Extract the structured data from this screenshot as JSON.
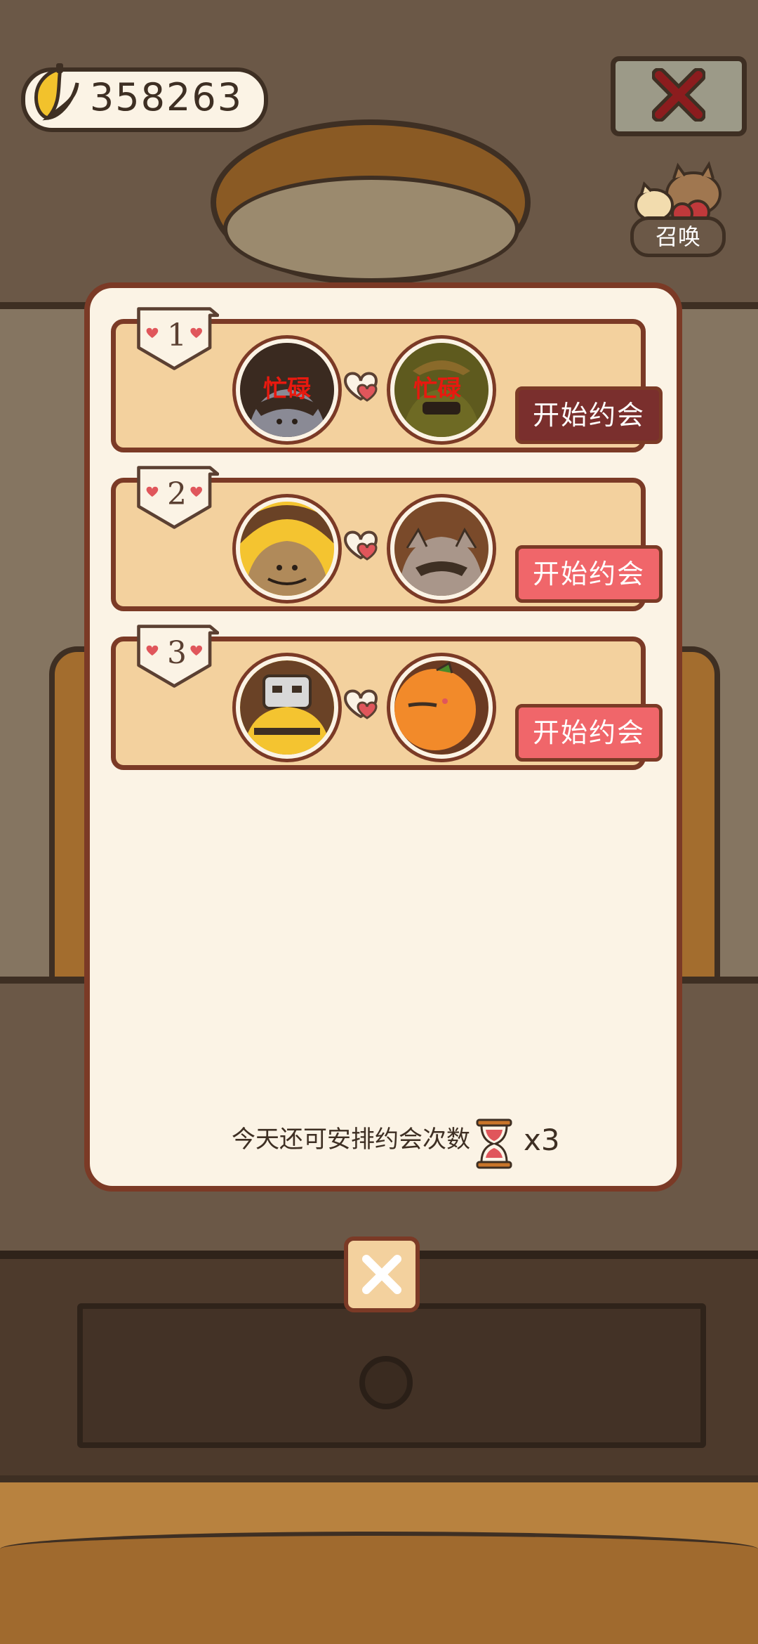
{
  "header": {
    "currency_value": "358263",
    "currency_icon": "banana-icon",
    "summon_label": "召唤"
  },
  "dates": [
    {
      "index": "1",
      "left_status": "忙碌",
      "right_status": "忙碌",
      "button_label": "开始约会",
      "button_state": "disabled"
    },
    {
      "index": "2",
      "left_status": "",
      "right_status": "",
      "button_label": "开始约会",
      "button_state": "enabled"
    },
    {
      "index": "3",
      "left_status": "",
      "right_status": "",
      "button_label": "开始约会",
      "button_state": "enabled"
    }
  ],
  "footer": {
    "remaining_label": "今天还可安排约会次数",
    "remaining_count": "x3",
    "remaining_icon": "hourglass-icon"
  },
  "colors": {
    "button_enabled": "#f0666a",
    "button_disabled": "#7a2f2d",
    "panel_border": "#7b3a26",
    "row_bg": "#f3d19e",
    "busy_text": "#e8190f"
  }
}
